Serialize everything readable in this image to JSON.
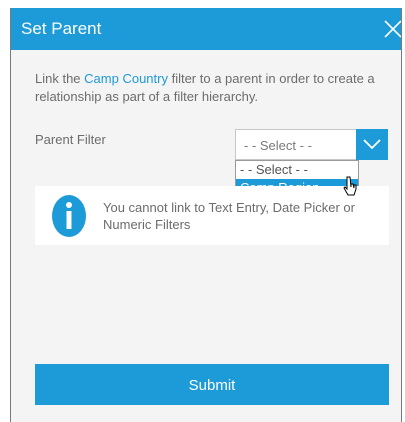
{
  "dialog": {
    "title": "Set Parent",
    "close_icon": "close-icon"
  },
  "message": {
    "prefix": "Link the ",
    "link_text": "Camp Country",
    "suffix": " filter to a parent in order to create a relationship as part of a filter hierarchy."
  },
  "parent_filter": {
    "label": "Parent Filter",
    "selected_value": "- - Select - -",
    "arrow_icon": "chevron-down-icon",
    "options": [
      {
        "label": "- - Select - -",
        "highlighted": false
      },
      {
        "label": "Camp Region",
        "highlighted": true
      }
    ]
  },
  "info": {
    "icon": "info-icon",
    "text": "You cannot link to Text Entry, Date Picker or Numeric Filters"
  },
  "submit": {
    "label": "Submit"
  },
  "colors": {
    "accent": "#1d9ad8",
    "panel_bg": "#f4f4f4",
    "text": "#6c6c6c"
  }
}
